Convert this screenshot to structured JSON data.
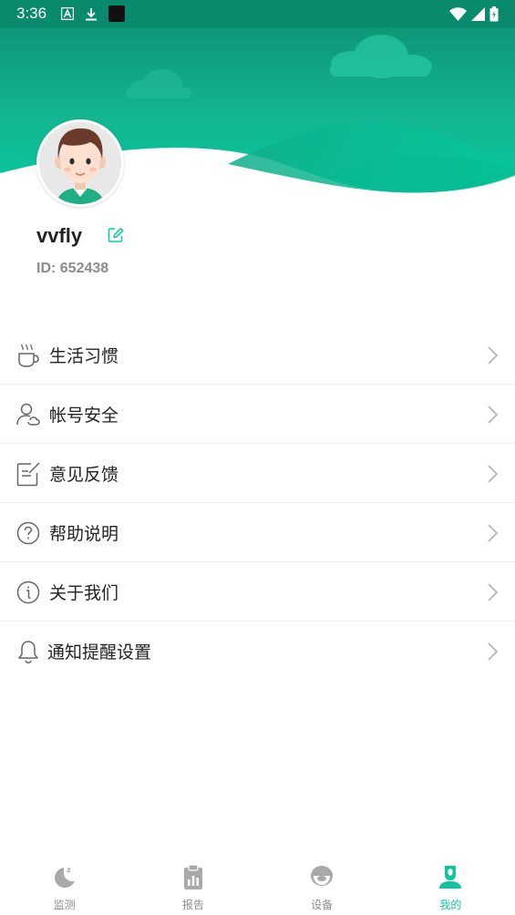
{
  "status_bar": {
    "time": "3:36",
    "icons_left": [
      "font-icon",
      "download-icon",
      "app-icon"
    ],
    "icons_right": [
      "wifi-icon",
      "signal-icon",
      "battery-icon"
    ]
  },
  "profile": {
    "username": "vvfly",
    "id_text": "ID: 652438",
    "avatar": "avatar",
    "edit_icon": "edit-icon"
  },
  "menu": {
    "items": [
      {
        "label": "生活习惯",
        "icon": "coffee-cup-icon"
      },
      {
        "label": "帐号安全",
        "icon": "user-shield-icon"
      },
      {
        "label": "意见反馈",
        "icon": "feedback-icon"
      },
      {
        "label": "帮助说明",
        "icon": "help-icon"
      },
      {
        "label": "关于我们",
        "icon": "info-icon"
      },
      {
        "label": "通知提醒设置",
        "icon": "bell-icon"
      }
    ]
  },
  "bottom_nav": {
    "items": [
      {
        "label": "监测",
        "icon": "moon-sleep-icon",
        "active": false
      },
      {
        "label": "报告",
        "icon": "clipboard-report-icon",
        "active": false
      },
      {
        "label": "设备",
        "icon": "device-icon",
        "active": false
      },
      {
        "label": "我的",
        "icon": "profile-icon",
        "active": true
      }
    ],
    "active_color": "#12c49c",
    "inactive_color": "#8d8d8d"
  },
  "colors": {
    "header_green_dark": "#0a8a6c",
    "header_green": "#14b48f",
    "header_green_light": "#08d3a5",
    "text_primary": "#222222",
    "text_secondary": "#8c8c8c"
  }
}
